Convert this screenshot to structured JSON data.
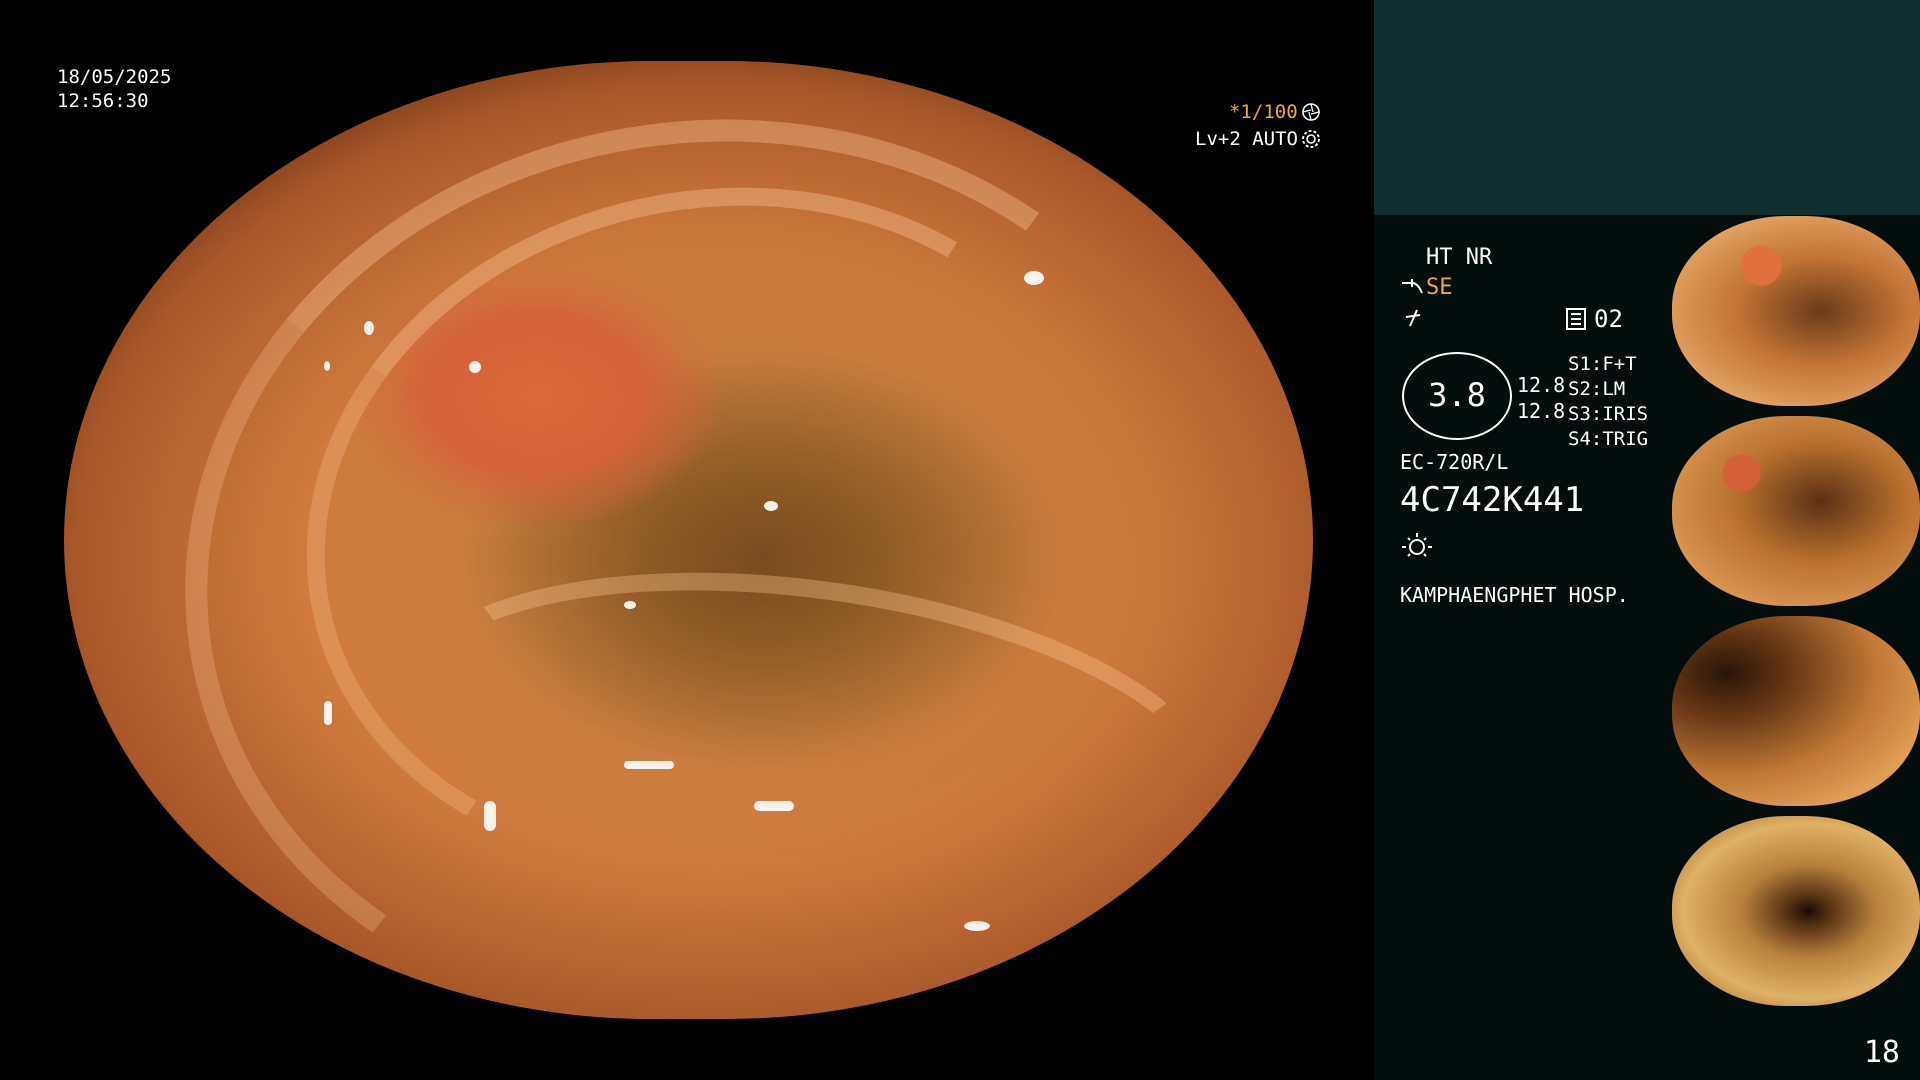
{
  "osd": {
    "date": "18/05/2025",
    "time": "12:56:30",
    "shutter": "*1/100",
    "level": "Lv+2 AUTO"
  },
  "panel": {
    "mode": "HT NR",
    "enhance": "SE",
    "image_count": "02",
    "gauge_value": "3.8",
    "gauge_side_1": "12.8",
    "gauge_side_2": "12.8",
    "settings": [
      {
        "key": "S1:",
        "value": "F+T"
      },
      {
        "key": "S2:",
        "value": "LM"
      },
      {
        "key": "S3:",
        "value": "IRIS"
      },
      {
        "key": "S4:",
        "value": "TRIG"
      }
    ],
    "scope_model": "EC-720R/L",
    "scope_serial": "4C742K441",
    "hospital": "KAMPHAENGPHET HOSP."
  },
  "page_number": "18",
  "icons": [
    "aperture-icon",
    "gear-icon",
    "scope-icon",
    "lightning-icon",
    "memory-icon",
    "light-icon"
  ],
  "colors": {
    "accent": "#f0a830",
    "panel_background": "#030d0b",
    "panel_top": "#0f2e2e"
  }
}
